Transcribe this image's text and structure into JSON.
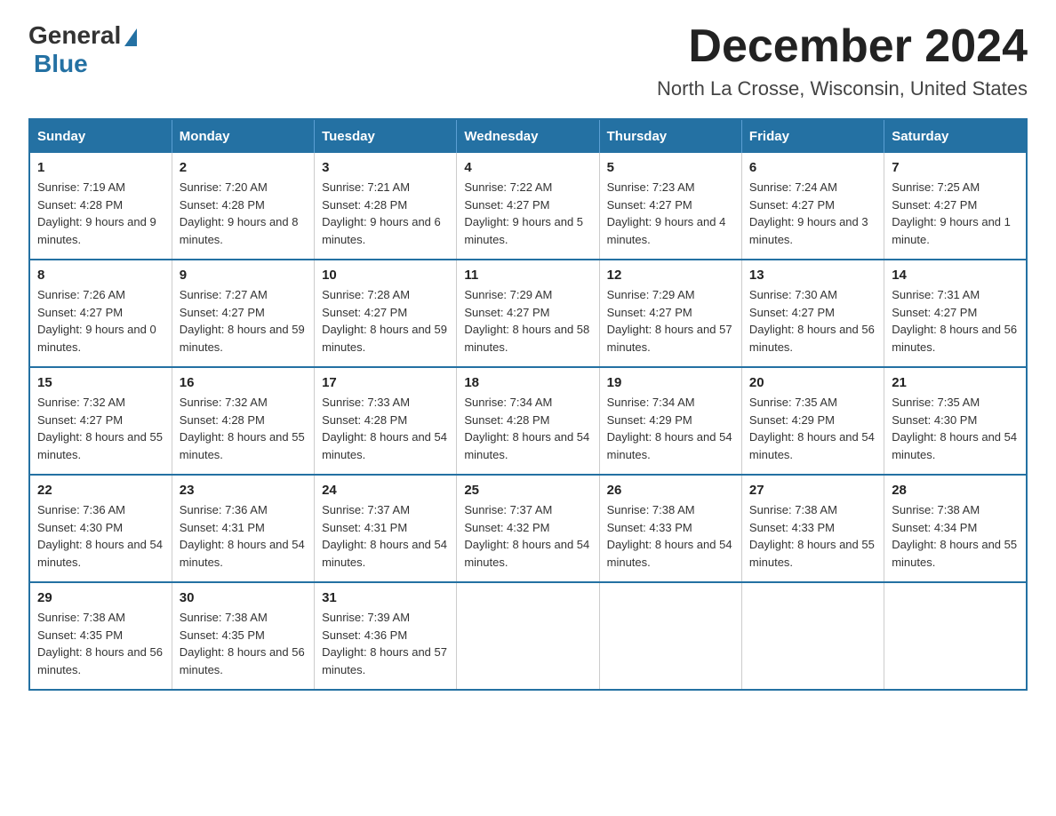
{
  "header": {
    "logo_general": "General",
    "logo_blue": "Blue",
    "title": "December 2024",
    "subtitle": "North La Crosse, Wisconsin, United States"
  },
  "days_of_week": [
    "Sunday",
    "Monday",
    "Tuesday",
    "Wednesday",
    "Thursday",
    "Friday",
    "Saturday"
  ],
  "weeks": [
    [
      {
        "day": "1",
        "sunrise": "7:19 AM",
        "sunset": "4:28 PM",
        "daylight": "9 hours and 9 minutes."
      },
      {
        "day": "2",
        "sunrise": "7:20 AM",
        "sunset": "4:28 PM",
        "daylight": "9 hours and 8 minutes."
      },
      {
        "day": "3",
        "sunrise": "7:21 AM",
        "sunset": "4:28 PM",
        "daylight": "9 hours and 6 minutes."
      },
      {
        "day": "4",
        "sunrise": "7:22 AM",
        "sunset": "4:27 PM",
        "daylight": "9 hours and 5 minutes."
      },
      {
        "day": "5",
        "sunrise": "7:23 AM",
        "sunset": "4:27 PM",
        "daylight": "9 hours and 4 minutes."
      },
      {
        "day": "6",
        "sunrise": "7:24 AM",
        "sunset": "4:27 PM",
        "daylight": "9 hours and 3 minutes."
      },
      {
        "day": "7",
        "sunrise": "7:25 AM",
        "sunset": "4:27 PM",
        "daylight": "9 hours and 1 minute."
      }
    ],
    [
      {
        "day": "8",
        "sunrise": "7:26 AM",
        "sunset": "4:27 PM",
        "daylight": "9 hours and 0 minutes."
      },
      {
        "day": "9",
        "sunrise": "7:27 AM",
        "sunset": "4:27 PM",
        "daylight": "8 hours and 59 minutes."
      },
      {
        "day": "10",
        "sunrise": "7:28 AM",
        "sunset": "4:27 PM",
        "daylight": "8 hours and 59 minutes."
      },
      {
        "day": "11",
        "sunrise": "7:29 AM",
        "sunset": "4:27 PM",
        "daylight": "8 hours and 58 minutes."
      },
      {
        "day": "12",
        "sunrise": "7:29 AM",
        "sunset": "4:27 PM",
        "daylight": "8 hours and 57 minutes."
      },
      {
        "day": "13",
        "sunrise": "7:30 AM",
        "sunset": "4:27 PM",
        "daylight": "8 hours and 56 minutes."
      },
      {
        "day": "14",
        "sunrise": "7:31 AM",
        "sunset": "4:27 PM",
        "daylight": "8 hours and 56 minutes."
      }
    ],
    [
      {
        "day": "15",
        "sunrise": "7:32 AM",
        "sunset": "4:27 PM",
        "daylight": "8 hours and 55 minutes."
      },
      {
        "day": "16",
        "sunrise": "7:32 AM",
        "sunset": "4:28 PM",
        "daylight": "8 hours and 55 minutes."
      },
      {
        "day": "17",
        "sunrise": "7:33 AM",
        "sunset": "4:28 PM",
        "daylight": "8 hours and 54 minutes."
      },
      {
        "day": "18",
        "sunrise": "7:34 AM",
        "sunset": "4:28 PM",
        "daylight": "8 hours and 54 minutes."
      },
      {
        "day": "19",
        "sunrise": "7:34 AM",
        "sunset": "4:29 PM",
        "daylight": "8 hours and 54 minutes."
      },
      {
        "day": "20",
        "sunrise": "7:35 AM",
        "sunset": "4:29 PM",
        "daylight": "8 hours and 54 minutes."
      },
      {
        "day": "21",
        "sunrise": "7:35 AM",
        "sunset": "4:30 PM",
        "daylight": "8 hours and 54 minutes."
      }
    ],
    [
      {
        "day": "22",
        "sunrise": "7:36 AM",
        "sunset": "4:30 PM",
        "daylight": "8 hours and 54 minutes."
      },
      {
        "day": "23",
        "sunrise": "7:36 AM",
        "sunset": "4:31 PM",
        "daylight": "8 hours and 54 minutes."
      },
      {
        "day": "24",
        "sunrise": "7:37 AM",
        "sunset": "4:31 PM",
        "daylight": "8 hours and 54 minutes."
      },
      {
        "day": "25",
        "sunrise": "7:37 AM",
        "sunset": "4:32 PM",
        "daylight": "8 hours and 54 minutes."
      },
      {
        "day": "26",
        "sunrise": "7:38 AM",
        "sunset": "4:33 PM",
        "daylight": "8 hours and 54 minutes."
      },
      {
        "day": "27",
        "sunrise": "7:38 AM",
        "sunset": "4:33 PM",
        "daylight": "8 hours and 55 minutes."
      },
      {
        "day": "28",
        "sunrise": "7:38 AM",
        "sunset": "4:34 PM",
        "daylight": "8 hours and 55 minutes."
      }
    ],
    [
      {
        "day": "29",
        "sunrise": "7:38 AM",
        "sunset": "4:35 PM",
        "daylight": "8 hours and 56 minutes."
      },
      {
        "day": "30",
        "sunrise": "7:38 AM",
        "sunset": "4:35 PM",
        "daylight": "8 hours and 56 minutes."
      },
      {
        "day": "31",
        "sunrise": "7:39 AM",
        "sunset": "4:36 PM",
        "daylight": "8 hours and 57 minutes."
      },
      null,
      null,
      null,
      null
    ]
  ]
}
